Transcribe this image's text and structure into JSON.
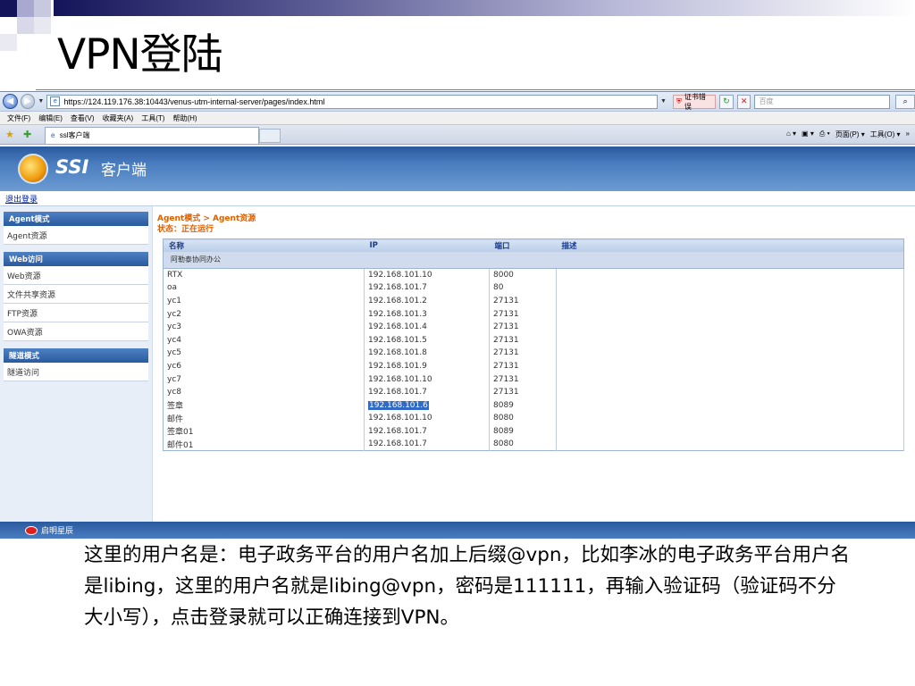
{
  "slide": {
    "title": "VPN登陆",
    "caption": "这里的用户名是：电子政务平台的用户名加上后缀@vpn，比如李冰的电子政务平台用户名是libing，这里的用户名就是libing@vpn，密码是111111，再输入验证码（验证码不分大小写），点击登录就可以正确连接到VPN。"
  },
  "browser": {
    "url": "https://124.119.176.38:10443/venus-utm-internal-server/pages/index.html",
    "cert_error": "证书错误",
    "search_placeholder": "百度",
    "menu": [
      "文件(F)",
      "编辑(E)",
      "查看(V)",
      "收藏夹(A)",
      "工具(T)",
      "帮助(H)"
    ],
    "tab_title": "ssl客户端",
    "command_bar": [
      "页面(P)",
      "工具(O)"
    ]
  },
  "app": {
    "logo_text": "SSI",
    "logo_subtitle": "客户端",
    "logout": "退出登录",
    "sidebar": {
      "groups": [
        {
          "title": "Agent模式",
          "items": [
            "Agent资源"
          ]
        },
        {
          "title": "Web访问",
          "items": [
            "Web资源",
            "文件共享资源",
            "FTP资源",
            "OWA资源"
          ]
        },
        {
          "title": "隧道模式",
          "items": [
            "隧道访问"
          ]
        }
      ]
    },
    "breadcrumb": "Agent模式 > Agent资源",
    "status": "状态：正在运行",
    "table": {
      "headers": [
        "名称",
        "IP",
        "端口",
        "描述"
      ],
      "group": "阿勒泰协同办公",
      "rows": [
        [
          "RTX",
          "192.168.101.10",
          "8000",
          ""
        ],
        [
          "oa",
          "192.168.101.7",
          "80",
          ""
        ],
        [
          "yc1",
          "192.168.101.2",
          "27131",
          ""
        ],
        [
          "yc2",
          "192.168.101.3",
          "27131",
          ""
        ],
        [
          "yc3",
          "192.168.101.4",
          "27131",
          ""
        ],
        [
          "yc4",
          "192.168.101.5",
          "27131",
          ""
        ],
        [
          "yc5",
          "192.168.101.8",
          "27131",
          ""
        ],
        [
          "yc6",
          "192.168.101.9",
          "27131",
          ""
        ],
        [
          "yc7",
          "192.168.101.10",
          "27131",
          ""
        ],
        [
          "yc8",
          "192.168.101.7",
          "27131",
          ""
        ],
        [
          "签章",
          "192.168.101.6",
          "8089",
          ""
        ],
        [
          "邮件",
          "192.168.101.10",
          "8080",
          ""
        ],
        [
          "签章01",
          "192.168.101.7",
          "8089",
          ""
        ],
        [
          "邮件01",
          "192.168.101.7",
          "8080",
          ""
        ]
      ],
      "selected_ip": "192.168.101.6"
    },
    "footer_logo": "启明星辰"
  }
}
